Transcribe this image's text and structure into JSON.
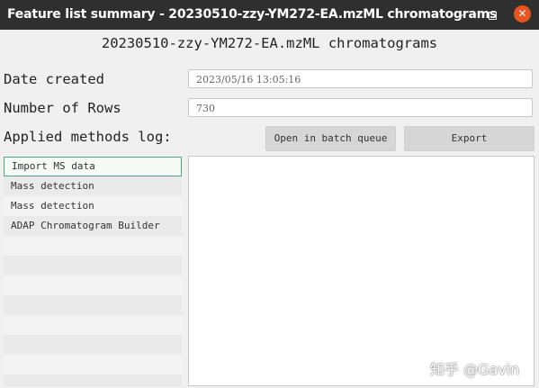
{
  "window": {
    "title": "Feature list summary - 20230510-zzy-YM272-EA.mzML chromatograms",
    "minimize_glyph": "–",
    "close_glyph": "✕"
  },
  "main": {
    "heading": "20230510-zzy-YM272-EA.mzML chromatograms",
    "date_label": "Date created",
    "date_value": "2023/05/16 13:05:16",
    "rows_label": "Number of Rows",
    "rows_value": "730",
    "methods_label": "Applied methods log:",
    "batch_button": "Open in batch queue",
    "export_button": "Export"
  },
  "methods": [
    "Import MS data",
    "Mass detection",
    "Mass detection",
    "ADAP Chromatogram Builder"
  ],
  "watermark": "知乎 @Gavin",
  "colors": {
    "titlebar": "#2f2f2f",
    "close_button": "#e95420",
    "selection_border": "#4aa887"
  }
}
